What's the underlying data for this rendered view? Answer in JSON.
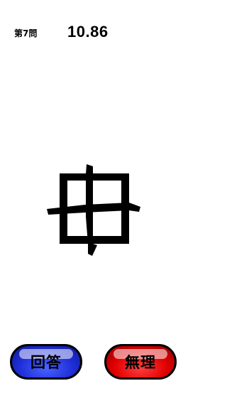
{
  "header": {
    "question_label": "第7問",
    "timer": "10.86"
  },
  "puzzle": {
    "glyph_name": "distorted-kanji-glyph"
  },
  "buttons": {
    "answer_label": "回答",
    "giveup_label": "無理"
  },
  "colors": {
    "answer_button": "#1f2fd8",
    "giveup_button": "#e00000",
    "glyph": "#000000",
    "background": "#ffffff"
  }
}
